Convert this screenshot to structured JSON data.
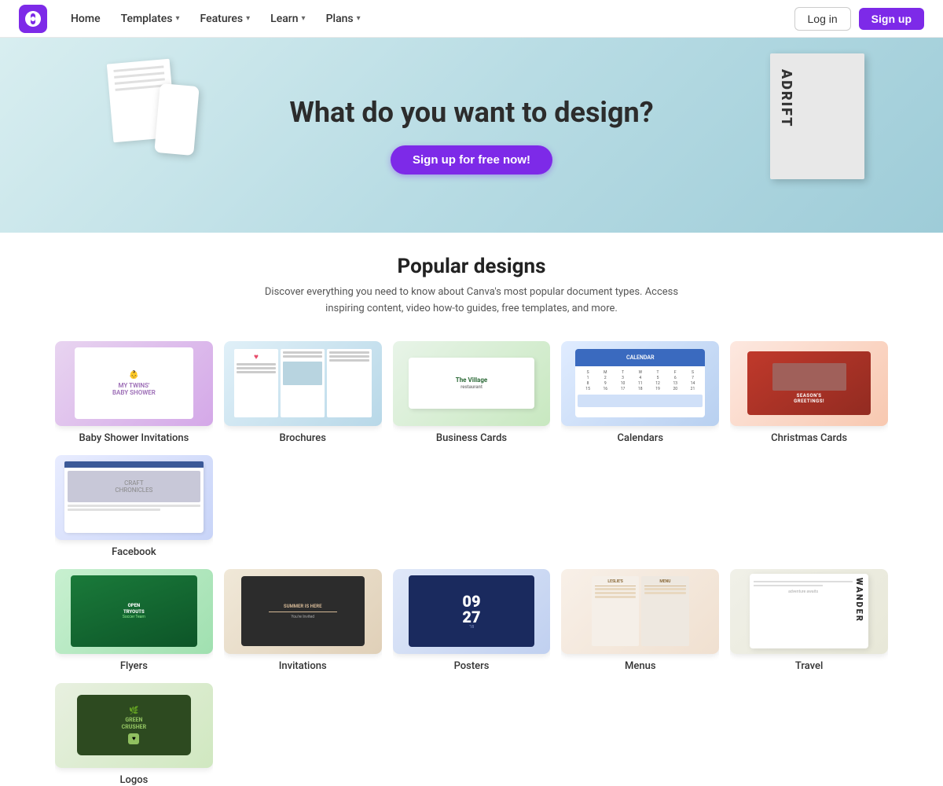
{
  "nav": {
    "logo_alt": "Canva",
    "home_label": "Home",
    "templates_label": "Templates",
    "features_label": "Features",
    "learn_label": "Learn",
    "plans_label": "Plans",
    "login_label": "Log in",
    "signup_label": "Sign up"
  },
  "hero": {
    "title": "What do you want to design?",
    "cta_label": "Sign up for free now!"
  },
  "popular": {
    "title": "Popular designs",
    "description": "Discover everything you need to know about Canva's most popular document types. Access inspiring content, video how-to guides, free templates, and more."
  },
  "cards_row1": [
    {
      "id": "baby-shower",
      "label": "Baby Shower Invitations"
    },
    {
      "id": "brochures",
      "label": "Brochures"
    },
    {
      "id": "business-cards",
      "label": "Business Cards"
    },
    {
      "id": "calendars",
      "label": "Calendars"
    },
    {
      "id": "christmas-cards",
      "label": "Christmas Cards"
    },
    {
      "id": "facebook",
      "label": "Facebook"
    }
  ],
  "cards_row2": [
    {
      "id": "flyers",
      "label": "Flyers"
    },
    {
      "id": "invitations",
      "label": "Invitations"
    },
    {
      "id": "posters",
      "label": "Posters"
    },
    {
      "id": "menus",
      "label": "Menus"
    },
    {
      "id": "travel",
      "label": "Travel"
    },
    {
      "id": "logos",
      "label": "Logos"
    }
  ]
}
